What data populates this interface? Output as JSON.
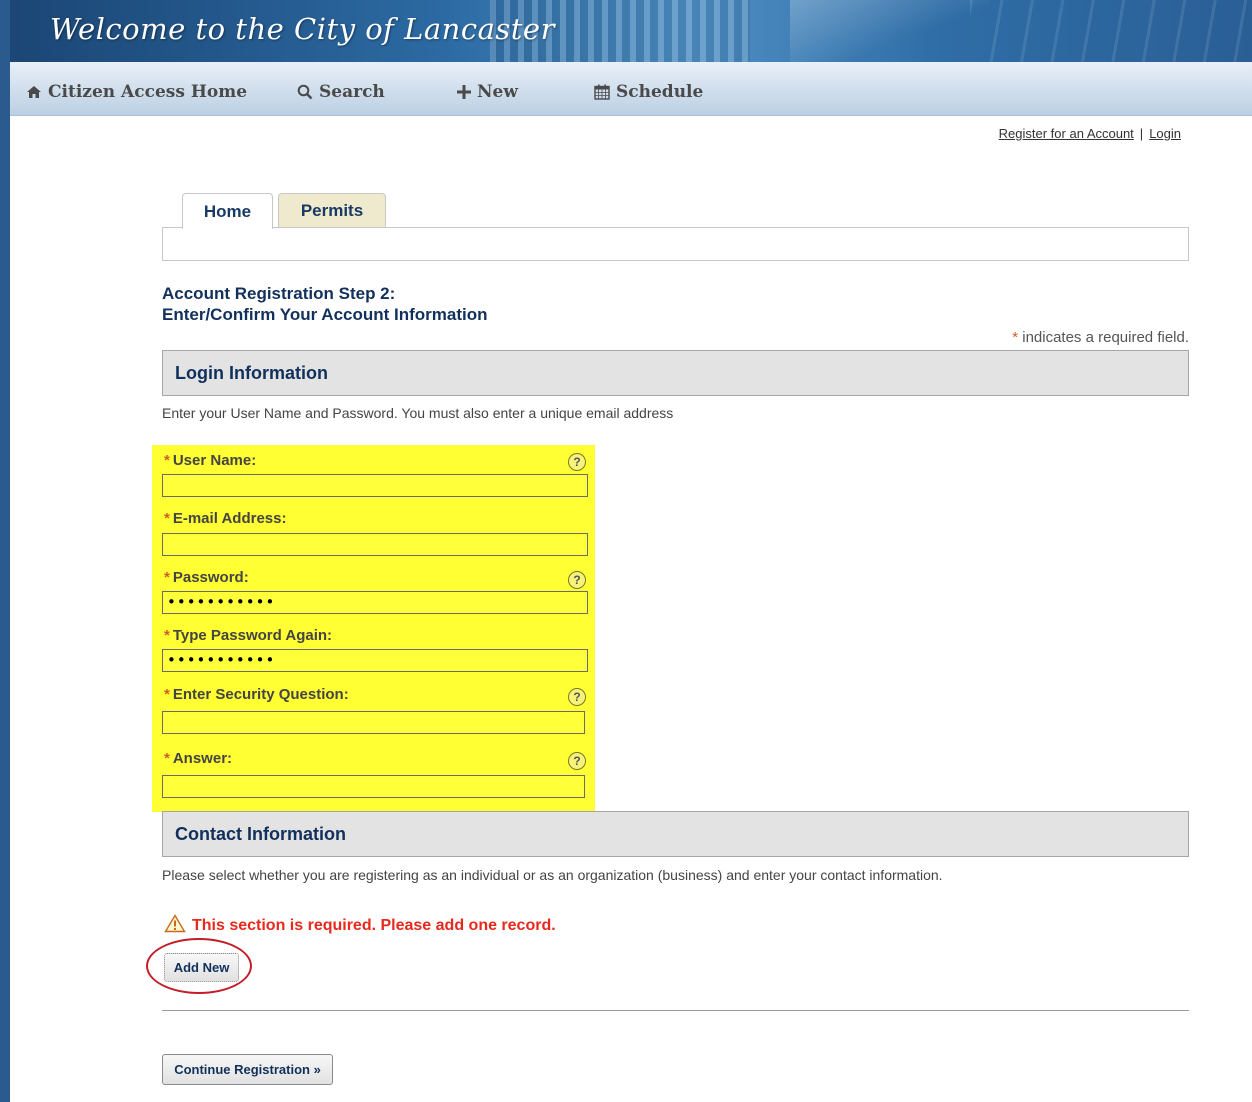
{
  "header": {
    "title": "Welcome to the City of Lancaster"
  },
  "nav": {
    "items": [
      {
        "label": "Citizen Access Home",
        "icon": "home-icon"
      },
      {
        "label": "Search",
        "icon": "search-icon"
      },
      {
        "label": "New",
        "icon": "plus-icon"
      },
      {
        "label": "Schedule",
        "icon": "calendar-icon"
      }
    ]
  },
  "top_links": {
    "register": "Register for an Account",
    "separator": "|",
    "login": "Login"
  },
  "tabs": [
    {
      "label": "Home",
      "active": true
    },
    {
      "label": "Permits",
      "active": false
    }
  ],
  "page": {
    "step_title_line1": "Account Registration Step 2:",
    "step_title_line2": "Enter/Confirm Your Account Information",
    "required_star": "*",
    "required_note": "indicates a required field."
  },
  "login_section": {
    "title": "Login Information",
    "description": "Enter your User Name and Password.  You must also enter a unique email address",
    "fields": [
      {
        "label": "User Name:",
        "value": "",
        "help": true
      },
      {
        "label": "E-mail Address:",
        "value": "",
        "help": false
      },
      {
        "label": "Password:",
        "value": "•••••••••••",
        "help": true
      },
      {
        "label": "Type Password Again:",
        "value": "•••••••••••",
        "help": false
      },
      {
        "label": "Enter Security Question:",
        "value": "",
        "help": true
      },
      {
        "label": "Answer:",
        "value": "",
        "help": true
      }
    ],
    "required_marker": "*",
    "help_glyph": "?",
    "highlight_color": "#ffff33"
  },
  "contact_section": {
    "title": "Contact Information",
    "description": "Please select whether you are registering as an individual or as an organization (business) and enter your contact information.",
    "warning": "This section is required. Please add one record.",
    "add_new_label": "Add New"
  },
  "continue_label": "Continue Registration »",
  "colors": {
    "brand_blue": "#12305c",
    "warning_red": "#e8291c",
    "required_orange": "#d25a2a"
  }
}
